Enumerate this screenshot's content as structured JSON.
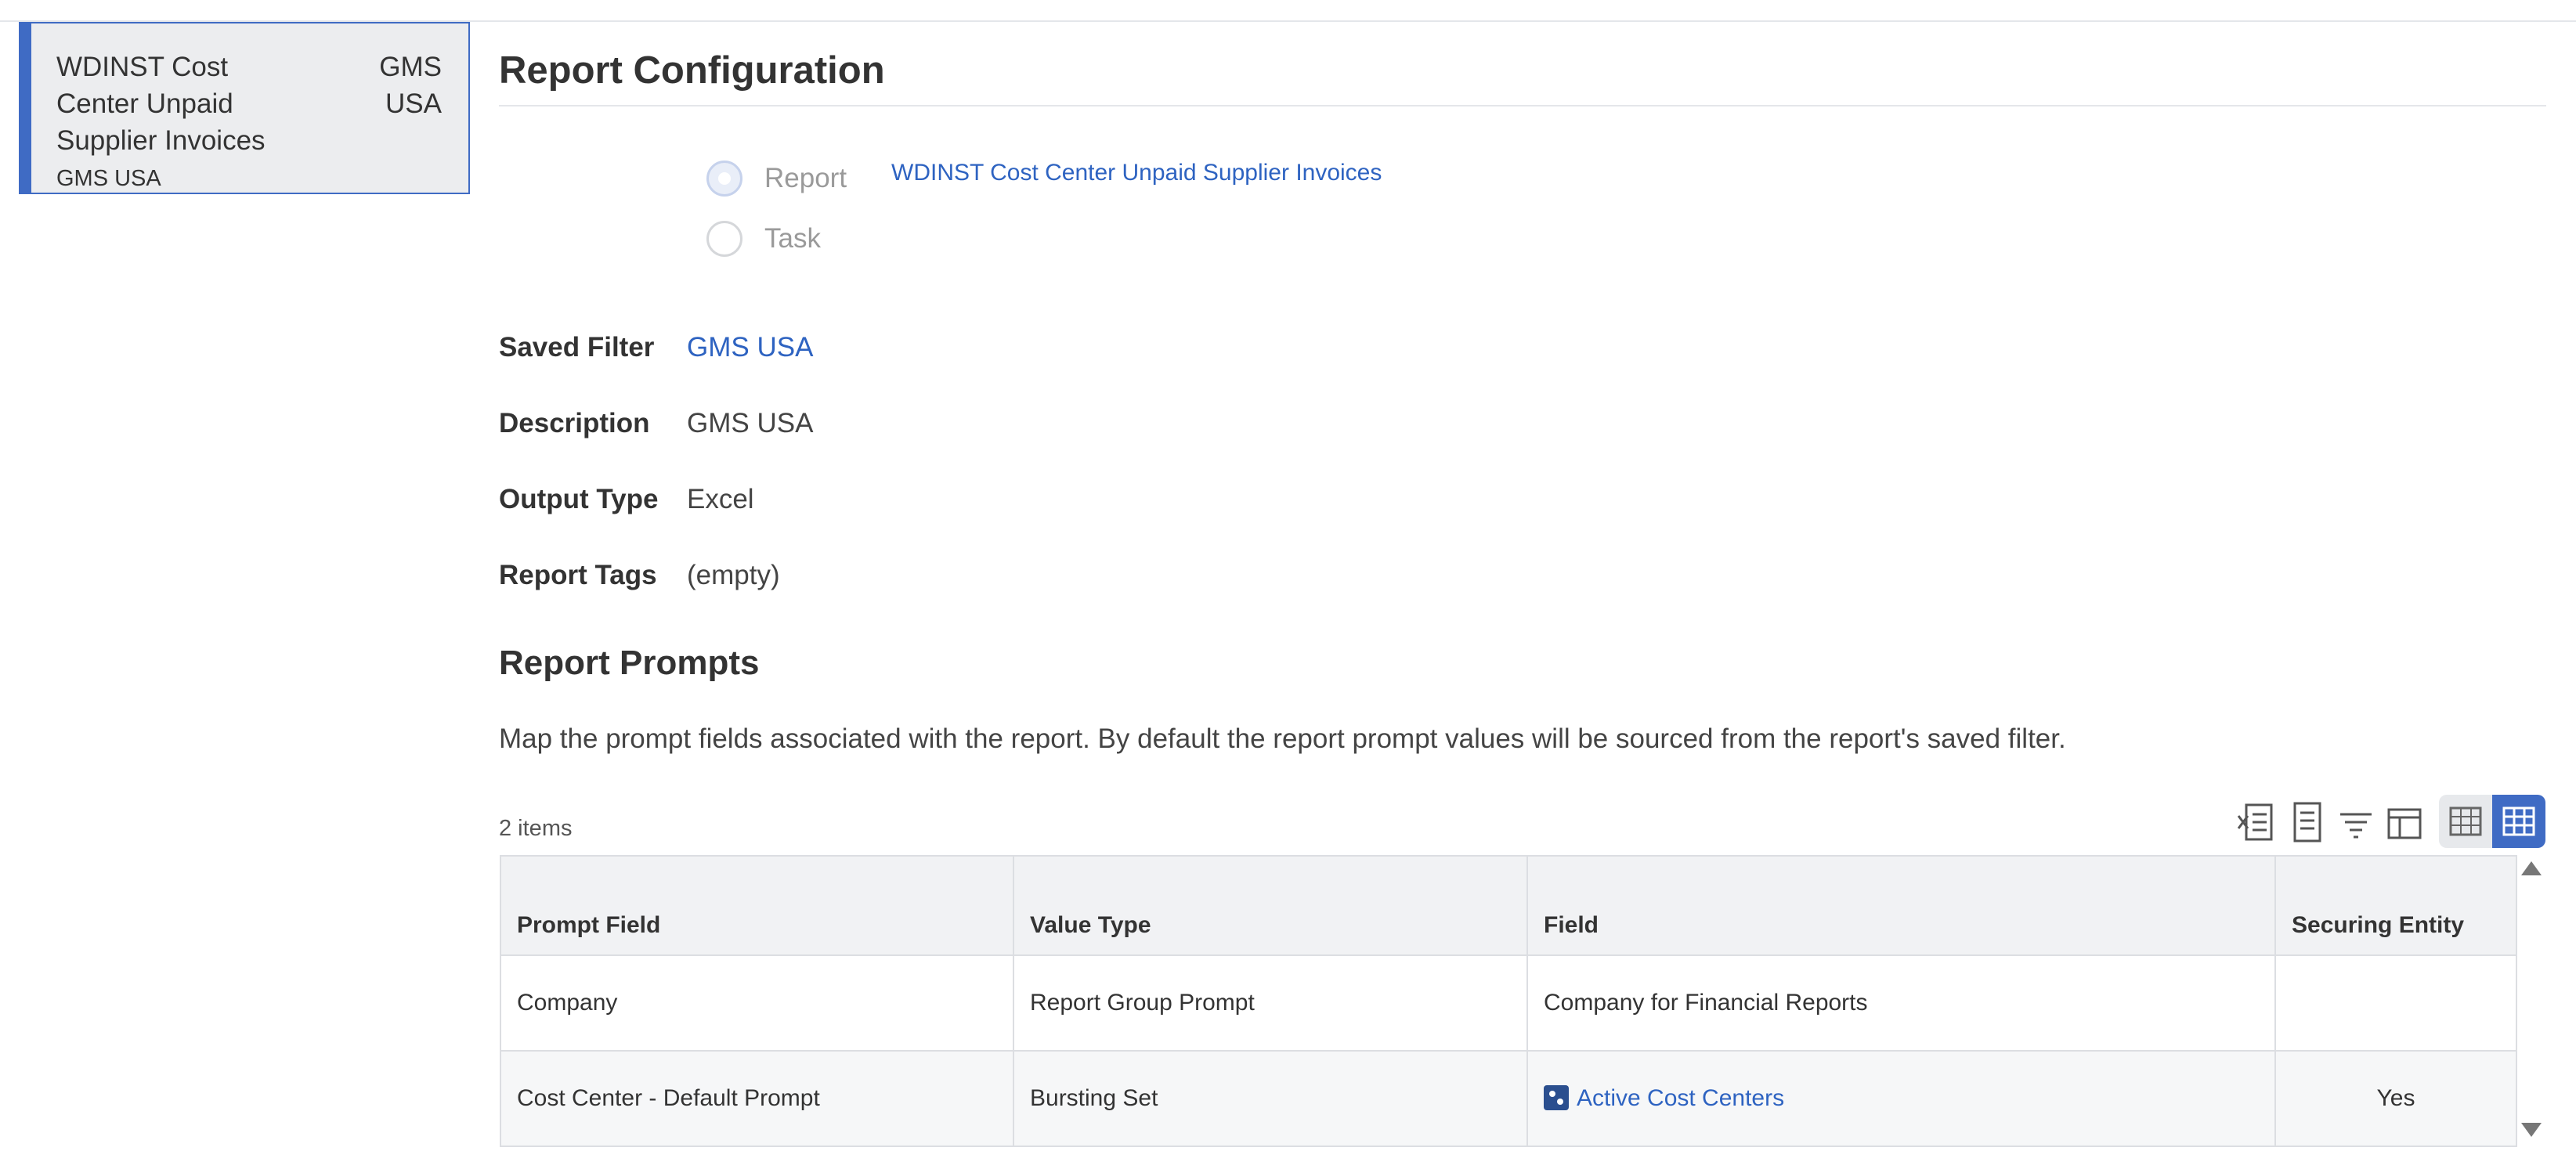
{
  "card": {
    "title": "WDINST Cost Center Unpaid Supplier Invoices",
    "tag": "GMS USA",
    "subtitle": "GMS USA"
  },
  "section_title": "Report Configuration",
  "radios": [
    {
      "label": "Report",
      "checked": true
    },
    {
      "label": "Task",
      "checked": false
    }
  ],
  "report_link": "WDINST Cost Center Unpaid Supplier Invoices",
  "fields": {
    "saved_filter": {
      "label": "Saved Filter",
      "value": "GMS USA"
    },
    "description": {
      "label": "Description",
      "value": "GMS USA"
    },
    "output_type": {
      "label": "Output Type",
      "value": "Excel"
    },
    "report_tags": {
      "label": "Report Tags",
      "value": "(empty)"
    }
  },
  "prompts": {
    "title": "Report Prompts",
    "description": "Map the prompt fields associated with the report.  By default the report prompt values will be sourced from the report's saved filter.",
    "count": "2 items",
    "columns": [
      "Prompt Field",
      "Value Type",
      "Field",
      "Securing Entity"
    ],
    "rows": [
      {
        "prompt_field": "Company",
        "value_type": "Report Group Prompt",
        "field": "Company for Financial Reports",
        "securing_entity": ""
      },
      {
        "prompt_field": "Cost Center - Default Prompt",
        "value_type": "Bursting Set",
        "field": "Active Cost Centers",
        "securing_entity": "Yes"
      }
    ]
  },
  "colors": {
    "accent": "#3f6bc4",
    "link": "#2e63c1"
  },
  "icons": [
    "excel-export-icon",
    "print-icon",
    "filter-icon",
    "column-layout-icon",
    "table-view-icon",
    "grid-view-icon",
    "related-actions-icon"
  ]
}
